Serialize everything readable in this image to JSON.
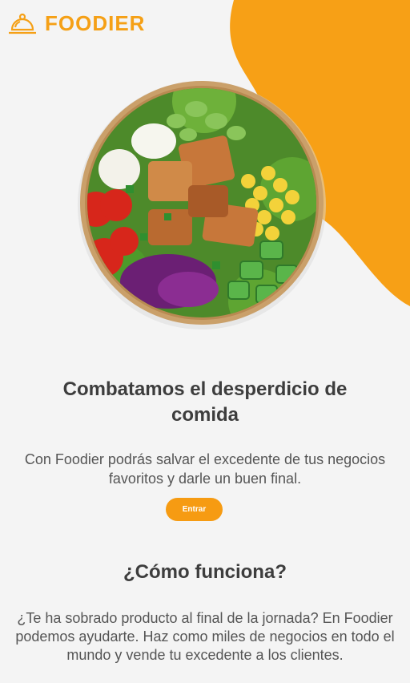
{
  "brand": {
    "name": "FOODIER",
    "logo_icon": "serving-bell-icon",
    "color": "#f5a016"
  },
  "hero": {
    "image": "salad-bowl-image"
  },
  "main": {
    "title": "Combatamos el desperdicio de comida",
    "subtitle": "Con Foodier podrás salvar el excedente de tus negocios favoritos y darle un buen final.",
    "cta_label": "Entrar"
  },
  "how": {
    "heading": "¿Cómo funciona?",
    "text": "¿Te ha sobrado producto al final de la jornada? En Foodier podemos ayudarte. Haz como miles de negocios en todo el mundo y vende tu excedente a los clientes."
  },
  "colors": {
    "accent": "#f69b12",
    "background": "#f4f4f4",
    "heading": "#3d3d3d"
  }
}
